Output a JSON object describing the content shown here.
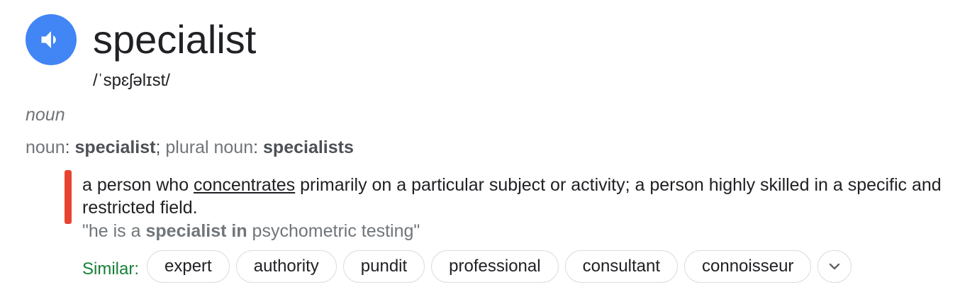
{
  "entry": {
    "speaker_icon": "volume-up-icon",
    "word": "specialist",
    "phonetic": "/ˈspɛʃəlɪst/",
    "part_of_speech": "noun"
  },
  "forms": {
    "label": "noun",
    "word": "specialist",
    "sep": ";",
    "plural_label": "plural noun",
    "plural": "specialists"
  },
  "definition": {
    "before_link": "a person who ",
    "link": "concentrates",
    "after_link": " primarily on a particular subject or activity; a person highly skilled in a specific and restricted field.",
    "example_open": "\"he is a ",
    "example_bold": "specialist in",
    "example_close": " psychometric testing\""
  },
  "similar": {
    "label": "Similar:",
    "chips": [
      "expert",
      "authority",
      "pundit",
      "professional",
      "consultant",
      "connoisseur"
    ],
    "more_icon": "chevron-down-icon"
  },
  "colors": {
    "speaker": "#4285f4",
    "def_bar": "#e8432e",
    "similar_label": "#188038",
    "muted": "#70757a"
  }
}
